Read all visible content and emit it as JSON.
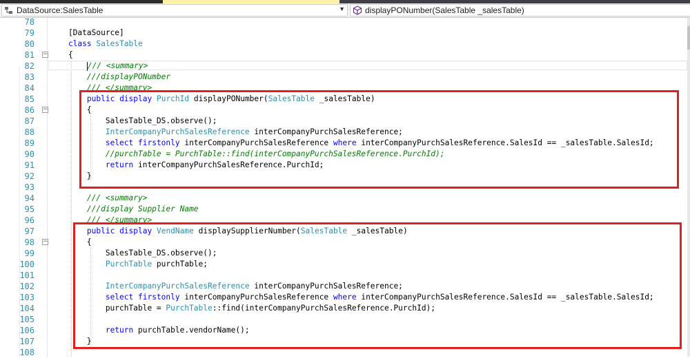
{
  "colors": {
    "keyword": "#0000ff",
    "type": "#2b91af",
    "comment": "#008000",
    "line_number": "#2b91af",
    "highlight_box": "#e41e1e"
  },
  "navbar": {
    "left_dropdown": {
      "label": "DataSource:SalesTable",
      "icon": "datasource-icon"
    },
    "right_dropdown": {
      "label": "displayPONumber(SalesTable _salesTable)",
      "icon": "method-icon"
    }
  },
  "code_lines": [
    {
      "n": "78",
      "tokens": []
    },
    {
      "n": "79",
      "tokens": [
        {
          "t": "    [DataSource]",
          "c": ""
        }
      ]
    },
    {
      "n": "80",
      "tokens": [
        {
          "t": "    ",
          "c": ""
        },
        {
          "t": "class",
          "c": "kw"
        },
        {
          "t": " ",
          "c": ""
        },
        {
          "t": "SalesTable",
          "c": "ty"
        }
      ]
    },
    {
      "n": "81",
      "tokens": [
        {
          "t": "    {",
          "c": ""
        }
      ],
      "fold": "−"
    },
    {
      "n": "82",
      "tokens": [
        {
          "t": "        ",
          "c": ""
        },
        {
          "t": "/// <summary>",
          "c": "cm"
        }
      ],
      "current": true
    },
    {
      "n": "83",
      "tokens": [
        {
          "t": "        ",
          "c": ""
        },
        {
          "t": "///displayPONumber",
          "c": "cm"
        }
      ]
    },
    {
      "n": "84",
      "tokens": [
        {
          "t": "        ",
          "c": ""
        },
        {
          "t": "/// </summary>",
          "c": "cm"
        }
      ]
    },
    {
      "n": "85",
      "tokens": [
        {
          "t": "        ",
          "c": ""
        },
        {
          "t": "public",
          "c": "kw"
        },
        {
          "t": " ",
          "c": ""
        },
        {
          "t": "display",
          "c": "kw"
        },
        {
          "t": " ",
          "c": ""
        },
        {
          "t": "PurchId",
          "c": "ty"
        },
        {
          "t": " displayPONumber(",
          "c": ""
        },
        {
          "t": "SalesTable",
          "c": "ty"
        },
        {
          "t": " _salesTable)",
          "c": ""
        }
      ]
    },
    {
      "n": "86",
      "tokens": [
        {
          "t": "        {",
          "c": ""
        }
      ],
      "fold": "−"
    },
    {
      "n": "87",
      "tokens": [
        {
          "t": "            SalesTable_DS.observe();",
          "c": ""
        }
      ]
    },
    {
      "n": "88",
      "tokens": [
        {
          "t": "            ",
          "c": ""
        },
        {
          "t": "InterCompanyPurchSalesReference",
          "c": "ty"
        },
        {
          "t": " interCompanyPurchSalesReference;",
          "c": ""
        }
      ]
    },
    {
      "n": "89",
      "tokens": [
        {
          "t": "            ",
          "c": ""
        },
        {
          "t": "select",
          "c": "kw"
        },
        {
          "t": " ",
          "c": ""
        },
        {
          "t": "firstonly",
          "c": "kw"
        },
        {
          "t": " interCompanyPurchSalesReference ",
          "c": ""
        },
        {
          "t": "where",
          "c": "kw"
        },
        {
          "t": " interCompanyPurchSalesReference.SalesId == _salesTable.SalesId;",
          "c": ""
        }
      ]
    },
    {
      "n": "90",
      "tokens": [
        {
          "t": "            ",
          "c": ""
        },
        {
          "t": "//purchTable = PurchTable::find(interCompanyPurchSalesReference.PurchId);",
          "c": "cm"
        }
      ]
    },
    {
      "n": "91",
      "tokens": [
        {
          "t": "            ",
          "c": ""
        },
        {
          "t": "return",
          "c": "kw"
        },
        {
          "t": " interCompanyPurchSalesReference.PurchId;",
          "c": ""
        }
      ]
    },
    {
      "n": "92",
      "tokens": [
        {
          "t": "        }",
          "c": ""
        }
      ]
    },
    {
      "n": "93",
      "tokens": []
    },
    {
      "n": "94",
      "tokens": [
        {
          "t": "        ",
          "c": ""
        },
        {
          "t": "/// <summary>",
          "c": "cm"
        }
      ]
    },
    {
      "n": "95",
      "tokens": [
        {
          "t": "        ",
          "c": ""
        },
        {
          "t": "///display Supplier Name",
          "c": "cm"
        }
      ]
    },
    {
      "n": "96",
      "tokens": [
        {
          "t": "        ",
          "c": ""
        },
        {
          "t": "/// </summary>",
          "c": "cm"
        }
      ]
    },
    {
      "n": "97",
      "tokens": [
        {
          "t": "        ",
          "c": ""
        },
        {
          "t": "public",
          "c": "kw"
        },
        {
          "t": " ",
          "c": ""
        },
        {
          "t": "display",
          "c": "kw"
        },
        {
          "t": " ",
          "c": ""
        },
        {
          "t": "VendName",
          "c": "ty"
        },
        {
          "t": " displaySupplierNumber(",
          "c": ""
        },
        {
          "t": "SalesTable",
          "c": "ty"
        },
        {
          "t": " _salesTable)",
          "c": ""
        }
      ]
    },
    {
      "n": "98",
      "tokens": [
        {
          "t": "        {",
          "c": ""
        }
      ],
      "fold": "−"
    },
    {
      "n": "99",
      "tokens": [
        {
          "t": "            SalesTable_DS.observe();",
          "c": ""
        }
      ]
    },
    {
      "n": "100",
      "tokens": [
        {
          "t": "            ",
          "c": ""
        },
        {
          "t": "PurchTable",
          "c": "ty"
        },
        {
          "t": " purchTable;",
          "c": ""
        }
      ]
    },
    {
      "n": "101",
      "tokens": []
    },
    {
      "n": "102",
      "tokens": [
        {
          "t": "            ",
          "c": ""
        },
        {
          "t": "InterCompanyPurchSalesReference",
          "c": "ty"
        },
        {
          "t": " interCompanyPurchSalesReference;",
          "c": ""
        }
      ]
    },
    {
      "n": "103",
      "tokens": [
        {
          "t": "            ",
          "c": ""
        },
        {
          "t": "select",
          "c": "kw"
        },
        {
          "t": " ",
          "c": ""
        },
        {
          "t": "firstonly",
          "c": "kw"
        },
        {
          "t": " interCompanyPurchSalesReference ",
          "c": ""
        },
        {
          "t": "where",
          "c": "kw"
        },
        {
          "t": " interCompanyPurchSalesReference.SalesId == _salesTable.SalesId;",
          "c": ""
        }
      ]
    },
    {
      "n": "104",
      "tokens": [
        {
          "t": "            purchTable = ",
          "c": ""
        },
        {
          "t": "PurchTable",
          "c": "ty"
        },
        {
          "t": "::find(interCompanyPurchSalesReference.PurchId);",
          "c": ""
        }
      ]
    },
    {
      "n": "105",
      "tokens": []
    },
    {
      "n": "106",
      "tokens": [
        {
          "t": "            ",
          "c": ""
        },
        {
          "t": "return",
          "c": "kw"
        },
        {
          "t": " purchTable.vendorName();",
          "c": ""
        }
      ]
    },
    {
      "n": "107",
      "tokens": [
        {
          "t": "        }",
          "c": ""
        }
      ]
    },
    {
      "n": "108",
      "tokens": []
    }
  ]
}
